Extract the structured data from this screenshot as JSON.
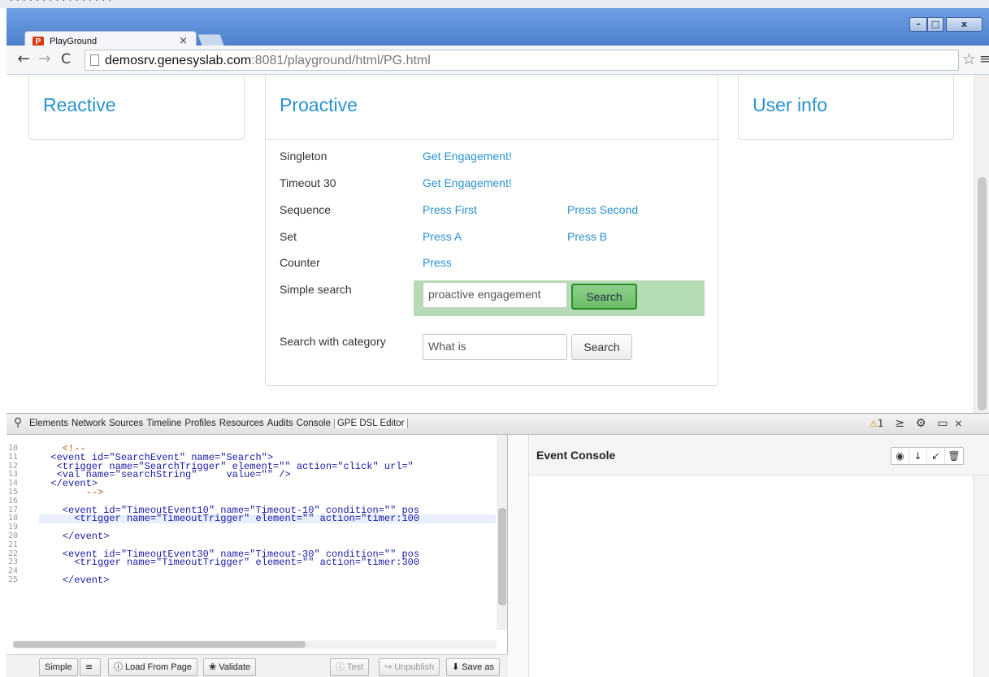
{
  "browser": {
    "tab_title": "PlayGround",
    "tab_close": "×",
    "url_host": "demosrv.genesyslab.com",
    "url_rest": ":8081/playground/html/PG.html",
    "window_controls": {
      "minimize": "–",
      "maximize": "□",
      "close": "x"
    },
    "icons": {
      "back": "←",
      "forward": "→",
      "reload": "C",
      "star": "☆",
      "menu": "≡"
    }
  },
  "page": {
    "reactive_title": "Reactive",
    "proactive_title": "Proactive",
    "userinfo_title": "User info",
    "rows": [
      {
        "label": "Singleton",
        "link1": "Get Engagement!",
        "link2": ""
      },
      {
        "label": "Timeout 30",
        "link1": "Get Engagement!",
        "link2": ""
      },
      {
        "label": "Sequence",
        "link1": "Press First",
        "link2": "Press Second"
      },
      {
        "label": "Set",
        "link1": "Press A",
        "link2": "Press B"
      },
      {
        "label": "Counter",
        "link1": "Press",
        "link2": ""
      }
    ],
    "simple_search": {
      "label": "Simple search",
      "value": "proactive engagement",
      "button": "Search"
    },
    "category_search": {
      "label": "Search with category",
      "value": "What is",
      "button": "Search"
    }
  },
  "devtools": {
    "tabs": [
      "Elements",
      "Network",
      "Sources",
      "Timeline",
      "Profiles",
      "Resources",
      "Audits",
      "Console",
      "GPE DSL Editor"
    ],
    "warning_count": "1",
    "editor": {
      "line_numbers": [
        "10",
        "11",
        "12",
        "13",
        "14",
        "15",
        "16",
        "17",
        "18",
        "19",
        "20",
        "21",
        "22",
        "23",
        "24",
        "25"
      ],
      "lines": [
        "    <!--",
        "  <event id=\"SearchEvent\" name=\"Search\">",
        "   <trigger name=\"SearchTrigger\" element=\"\" action=\"click\" url=\"",
        "   <val name=\"searchString\"     value=\"\" />",
        "  </event>",
        "        -->",
        "",
        "    <event id=\"TimeoutEvent10\" name=\"Timeout-10\" condition=\"\" pos",
        "      <trigger name=\"TimeoutTrigger\" element=\"\" action=\"timer:100",
        "",
        "    </event>",
        "",
        "    <event id=\"TimeoutEvent30\" name=\"Timeout-30\" condition=\"\" pos",
        "      <trigger name=\"TimeoutTrigger\" element=\"\" action=\"timer:300",
        "",
        "    </event>"
      ],
      "buttons": {
        "simple": "Simple",
        "load": "Load From Page",
        "validate": "Validate",
        "test": "Test",
        "unpublish": "Unpublish",
        "save": "Save as"
      }
    },
    "event_console": {
      "title": "Event Console"
    }
  }
}
